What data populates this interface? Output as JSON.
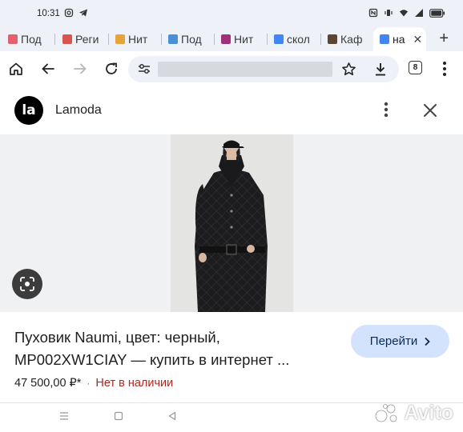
{
  "status_bar": {
    "time": "10:31"
  },
  "tabs": [
    {
      "label": "Под",
      "favicon_color": "#e4606d"
    },
    {
      "label": "Реги",
      "favicon_color": "#d9534f"
    },
    {
      "label": "Нит",
      "favicon_color": "#e5a33a"
    },
    {
      "label": "Под",
      "favicon_color": "#4a90d9"
    },
    {
      "label": "Нит",
      "favicon_color": "#a0307a"
    },
    {
      "label": "скол",
      "favicon_color": "#4285f4"
    },
    {
      "label": "Каф",
      "favicon_color": "#5b4636"
    },
    {
      "label": "на",
      "favicon_color": "#4285f4"
    }
  ],
  "toolbar": {
    "tab_count": "8"
  },
  "sheet": {
    "logo_text": "la",
    "site_name": "Lamoda"
  },
  "product": {
    "title_line1": "Пуховик Naumi, цвет: черный,",
    "title_line2": "MP002XW1CIAY — купить в интернет ...",
    "price": "47 500,00 ₽*",
    "separator": "·",
    "stock": "Нет в наличии",
    "go_label": "Перейти"
  },
  "watermark": {
    "text": "Avito"
  },
  "colors": {
    "accent": "#d3e3fd",
    "stock": "#b3261e",
    "chrome": "#eef1f7"
  }
}
